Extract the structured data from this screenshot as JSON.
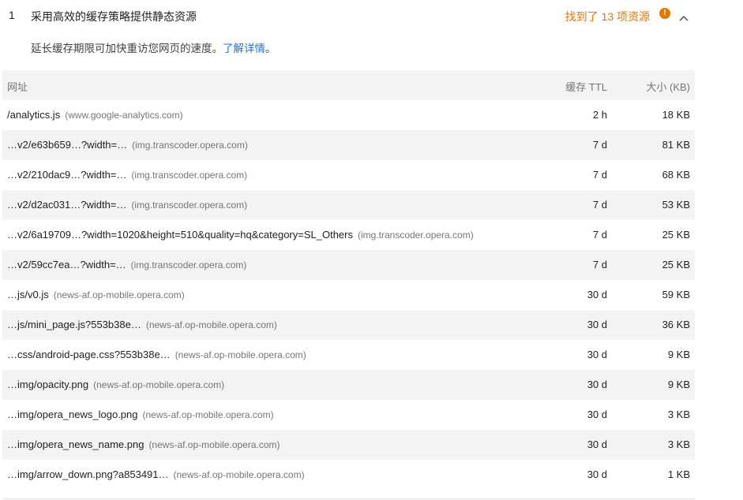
{
  "audit": {
    "index": "1",
    "title": "采用高效的缓存策略提供静态资源",
    "savings": "找到了 13 项资源",
    "warn_icon": "!",
    "description": "延长缓存期限可加快重访您网页的速度。",
    "learn_more": "了解详情",
    "desc_end": "。"
  },
  "table": {
    "headers": {
      "url": "网址",
      "ttl": "缓存 TTL",
      "size": "大小 (KB)"
    },
    "rows": [
      {
        "url": "/analytics.js",
        "host": "(www.google-analytics.com)",
        "ttl": "2 h",
        "size": "18 KB"
      },
      {
        "url": "…v2/e63b659…?width=…",
        "host": "(img.transcoder.opera.com)",
        "ttl": "7 d",
        "size": "81 KB"
      },
      {
        "url": "…v2/210dac9…?width=…",
        "host": "(img.transcoder.opera.com)",
        "ttl": "7 d",
        "size": "68 KB"
      },
      {
        "url": "…v2/d2ac031…?width=…",
        "host": "(img.transcoder.opera.com)",
        "ttl": "7 d",
        "size": "53 KB"
      },
      {
        "url": "…v2/6a19709…?width=1020&height=510&quality=hq&category=SL_Others",
        "host": "(img.transcoder.opera.com)",
        "ttl": "7 d",
        "size": "25 KB"
      },
      {
        "url": "…v2/59cc7ea…?width=…",
        "host": "(img.transcoder.opera.com)",
        "ttl": "7 d",
        "size": "25 KB"
      },
      {
        "url": "…js/v0.js",
        "host": "(news-af.op-mobile.opera.com)",
        "ttl": "30 d",
        "size": "59 KB"
      },
      {
        "url": "…js/mini_page.js?553b38e…",
        "host": "(news-af.op-mobile.opera.com)",
        "ttl": "30 d",
        "size": "36 KB"
      },
      {
        "url": "…css/android-page.css?553b38e…",
        "host": "(news-af.op-mobile.opera.com)",
        "ttl": "30 d",
        "size": "9 KB"
      },
      {
        "url": "…img/opacity.png",
        "host": "(news-af.op-mobile.opera.com)",
        "ttl": "30 d",
        "size": "9 KB"
      },
      {
        "url": "…img/opera_news_logo.png",
        "host": "(news-af.op-mobile.opera.com)",
        "ttl": "30 d",
        "size": "3 KB"
      },
      {
        "url": "…img/opera_news_name.png",
        "host": "(news-af.op-mobile.opera.com)",
        "ttl": "30 d",
        "size": "3 KB"
      },
      {
        "url": "…img/arrow_down.png?a853491…",
        "host": "(news-af.op-mobile.opera.com)",
        "ttl": "30 d",
        "size": "1 KB"
      }
    ]
  },
  "icons": {
    "warning": "warning-icon",
    "collapse": "chevron-up-icon"
  },
  "colors": {
    "savings": "#e67700",
    "link": "#1a73e8",
    "shaded_row": "#f3f3f3"
  }
}
